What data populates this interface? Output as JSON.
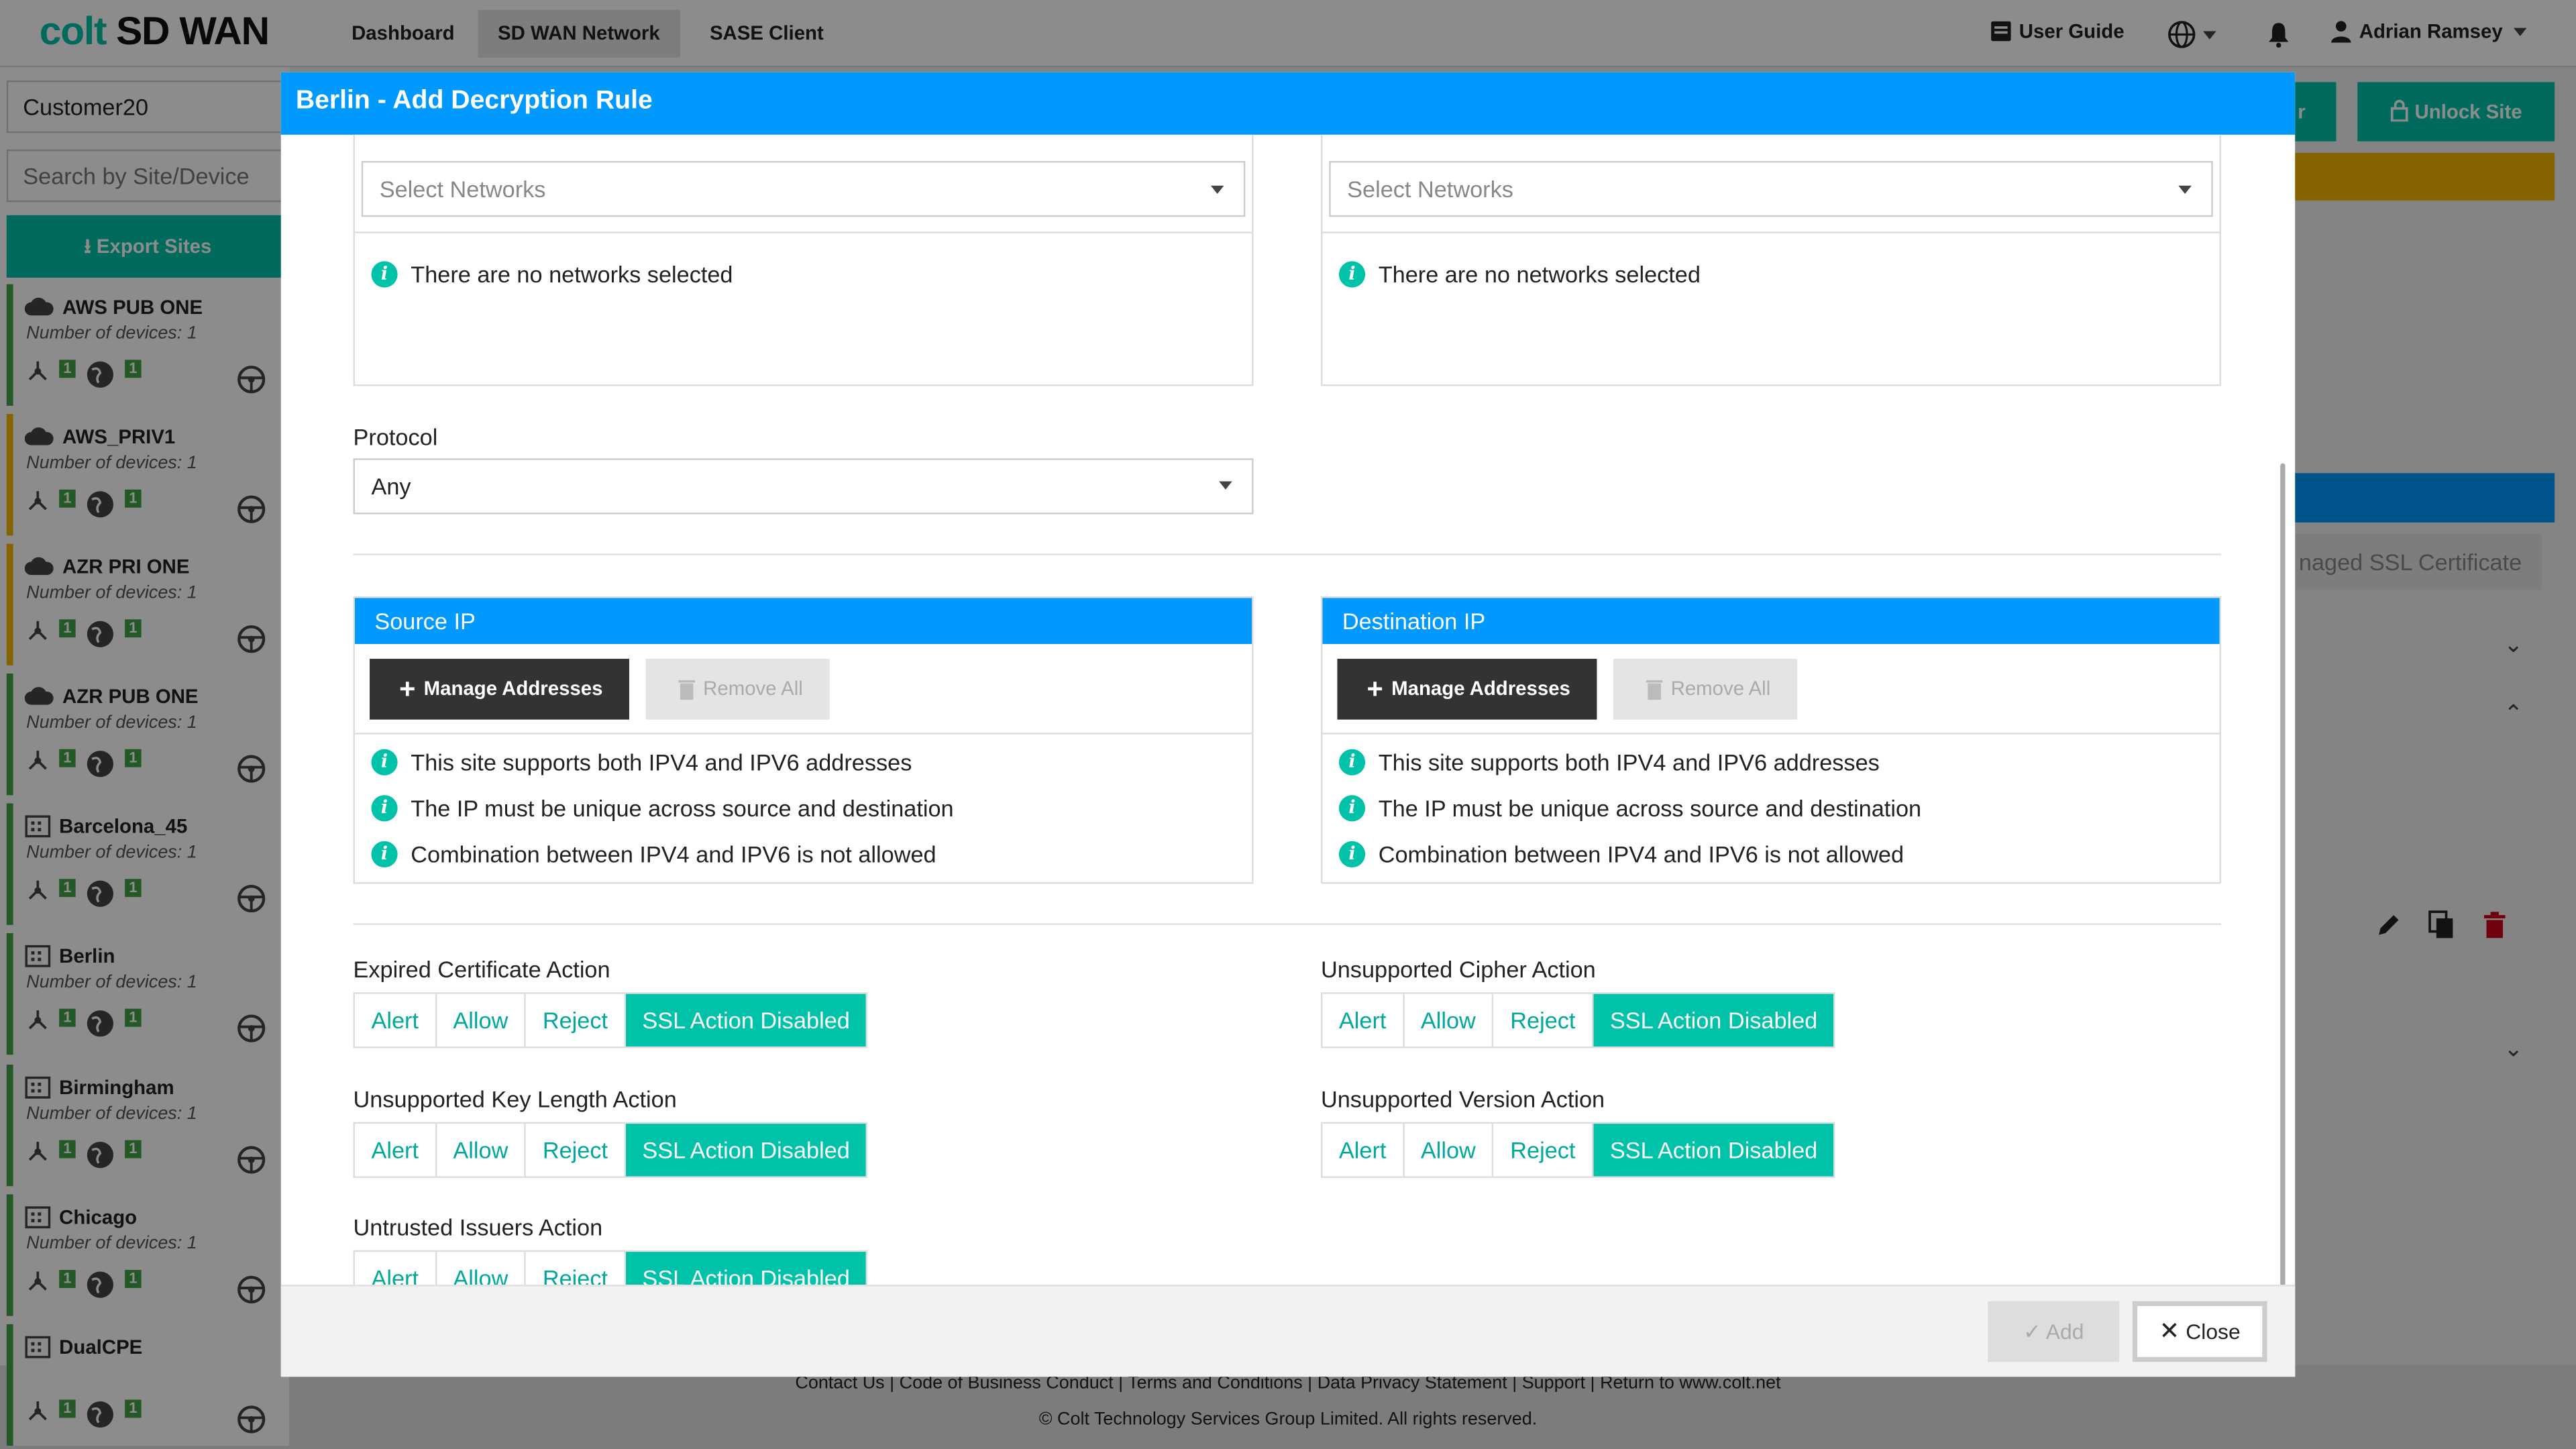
{
  "app": {
    "logo_brand": "colt",
    "logo_product": "SD WAN"
  },
  "nav": [
    {
      "label": "Dashboard"
    },
    {
      "label": "SD WAN Network"
    },
    {
      "label": "SASE Client"
    }
  ],
  "topright": {
    "user_guide": "User Guide",
    "user_name": "Adrian Ramsey"
  },
  "sidebar": {
    "customer": "Customer20",
    "search_placeholder": "Search by Site/Device",
    "export_label": "Export Sites",
    "sites": [
      {
        "name": "AWS PUB ONE",
        "devices": "Number of devices: 1",
        "type": "cloud",
        "status": "green"
      },
      {
        "name": "AWS_PRIV1",
        "devices": "Number of devices: 1",
        "type": "cloud",
        "status": "warn"
      },
      {
        "name": "AZR PRI ONE",
        "devices": "Number of devices: 1",
        "type": "cloud",
        "status": "warn"
      },
      {
        "name": "AZR PUB ONE",
        "devices": "Number of devices: 1",
        "type": "cloud",
        "status": "green"
      },
      {
        "name": "Barcelona_45",
        "devices": "Number of devices: 1",
        "type": "building",
        "status": "green"
      },
      {
        "name": "Berlin",
        "devices": "Number of devices: 1",
        "type": "building",
        "status": "green"
      },
      {
        "name": "Birmingham",
        "devices": "Number of devices: 1",
        "type": "building",
        "status": "green"
      },
      {
        "name": "Chicago",
        "devices": "Number of devices: 1",
        "type": "building",
        "status": "green"
      },
      {
        "name": "DualCPE",
        "devices": "",
        "type": "building",
        "status": "green"
      }
    ],
    "badge_value": "1"
  },
  "background": {
    "unlock_label": "Unlock Site",
    "ssl_fragment": "naged SSL Certificate",
    "partial_btn_fragment": "r"
  },
  "footer": {
    "links": [
      "Contact Us",
      "Code of Business Conduct",
      "Terms and Conditions",
      "Data Privacy Statement",
      "Support",
      "Return to www.colt.net"
    ],
    "copyright": "© Colt Technology Services Group Limited. All rights reserved."
  },
  "modal": {
    "title": "Berlin - Add Decryption Rule",
    "networks_left": {
      "placeholder": "Select Networks",
      "empty_msg": "There are no networks selected"
    },
    "networks_right": {
      "placeholder": "Select Networks",
      "empty_msg": "There are no networks selected"
    },
    "protocol": {
      "label": "Protocol",
      "value": "Any"
    },
    "source_ip": {
      "title": "Source IP"
    },
    "destination_ip": {
      "title": "Destination IP"
    },
    "manage_label": "Manage Addresses",
    "remove_label": "Remove All",
    "ip_notes": [
      "This site supports both IPV4 and IPV6 addresses",
      "The IP must be unique across source and destination",
      "Combination between IPV4 and IPV6 is not allowed"
    ],
    "action_options": [
      "Alert",
      "Allow",
      "Reject",
      "SSL Action Disabled"
    ],
    "actions": [
      {
        "label": "Expired Certificate Action",
        "selected": "SSL Action Disabled"
      },
      {
        "label": "Unsupported Cipher Action",
        "selected": "SSL Action Disabled"
      },
      {
        "label": "Unsupported Key Length Action",
        "selected": "SSL Action Disabled"
      },
      {
        "label": "Unsupported Version Action",
        "selected": "SSL Action Disabled"
      },
      {
        "label": "Untrusted Issuers Action",
        "selected": "SSL Action Disabled"
      }
    ],
    "add_label": "Add",
    "close_label": "Close"
  },
  "colors": {
    "accent_teal": "#00c2a8",
    "header_blue": "#0099ff",
    "status_green": "#43a047",
    "status_warn": "#f2b600",
    "dark_button": "#333333"
  }
}
